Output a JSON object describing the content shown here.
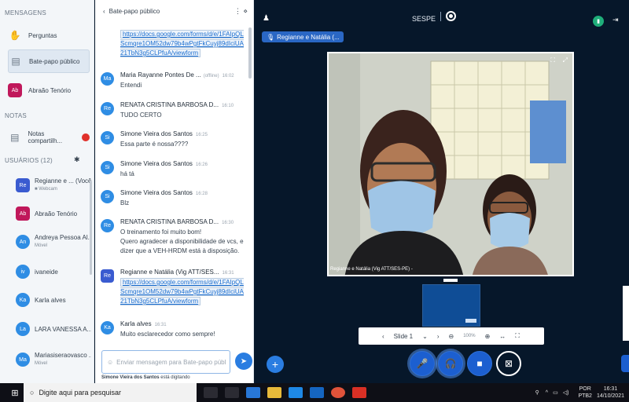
{
  "sidebar": {
    "messages_title": "MENSAGENS",
    "nav": [
      {
        "label": "Perguntas",
        "icon": "raised-hand-icon"
      },
      {
        "label": "Bate-papo público",
        "icon": "chat-icon"
      },
      {
        "label": "Abraão Tenório",
        "avatar": "Ab"
      }
    ],
    "notes_title": "NOTAS",
    "notes_item": "Notas compartilh...",
    "users_title": "USUÁRIOS (12)",
    "users": [
      {
        "initials": "Re",
        "name": "Regianne e ... (Você)",
        "sub": "■ Webcam",
        "color": "#3a5bd0"
      },
      {
        "initials": "Ab",
        "name": "Abraão Tenório",
        "sub": "",
        "color": "#c0185b"
      },
      {
        "initials": "An",
        "name": "Andreya Pessoa Al...",
        "sub": "Móvel",
        "color": "#2f8de4"
      },
      {
        "initials": "iv",
        "name": "ivaneide",
        "sub": "",
        "color": "#2f8de4"
      },
      {
        "initials": "Ka",
        "name": "Karla alves",
        "sub": "",
        "color": "#2f8de4"
      },
      {
        "initials": "La",
        "name": "LARA VANESSA A...",
        "sub": "",
        "color": "#2f8de4"
      },
      {
        "initials": "Ma",
        "name": "Mariasiseraovasco ...",
        "sub": "Móvel",
        "color": "#2f8de4"
      }
    ]
  },
  "chat": {
    "back_label": "Bate-papo público",
    "header_icons": "⋮ ⋄",
    "messages": [
      {
        "avatar": "",
        "name": "",
        "time": "",
        "lines": [],
        "link": "https://docs.google.com/forms/d/e/1FAIpQLScmqre1OM52dw79b4wPgtFkCuyj89dIciUA21TbN3g5CLPfuA/viewform"
      },
      {
        "avatar": "Ma",
        "name": "Maria Rayanne Pontes De ...",
        "status": "(offline)",
        "time": "16:02",
        "lines": [
          "Entendi"
        ]
      },
      {
        "avatar": "Re",
        "name": "RENATA CRISTINA BARBOSA D...",
        "time": "16:10",
        "lines": [
          "TUDO CERTO"
        ]
      },
      {
        "avatar": "Si",
        "name": "Simone Vieira dos Santos",
        "time": "16:25",
        "lines": [
          "Essa parte é nossa????"
        ]
      },
      {
        "avatar": "Si",
        "name": "Simone Vieira dos Santos",
        "time": "16:26",
        "lines": [
          "há tá"
        ]
      },
      {
        "avatar": "Si",
        "name": "Simone Vieira dos Santos",
        "time": "16:28",
        "lines": [
          "Blz"
        ]
      },
      {
        "avatar": "Re",
        "name": "RENATA CRISTINA BARBOSA D...",
        "time": "16:30",
        "lines": [
          "O treinamento foi muito bom!",
          "Quero agradecer a disponibilidade de vcs, e dizer que a VEH-HRDM está à disposição."
        ]
      },
      {
        "avatar": "Re",
        "name": "Regianne e Natália (Vig ATT/SES...",
        "time": "16:31",
        "lines": [],
        "link": "https://docs.google.com/forms/d/e/1FAIpQLScmqre1OM52dw79b4wPgtFkCuyj89dIciUA21TbN3g5CLPfuA/viewform"
      },
      {
        "avatar": "Ka",
        "name": "Karla alves",
        "time": "16:31",
        "lines": [
          "Muito esclarecedor como sempre!"
        ]
      }
    ],
    "compose_placeholder": "Enviar mensagem para Bate-papo públ",
    "typing_user": "Simone Vieira dos Santos",
    "typing_text": "está digitando"
  },
  "stage": {
    "meeting_title": "SESPE",
    "talker": "Regianne e Natália (...",
    "video_caption": "Regianne e Natália (Vig ATT/SES-PE) -",
    "slide_label": "Slide 1",
    "zoom": "100%"
  },
  "taskbar": {
    "search_placeholder": "Digite aqui para pesquisar",
    "lang": "POR",
    "lang_sub": "PTB2",
    "time": "16:31",
    "date": "14/10/2021"
  },
  "colors": {
    "accent": "#2a7de1",
    "stage_bg": "#06172a",
    "sidebar_bg": "#f3f6f9"
  }
}
